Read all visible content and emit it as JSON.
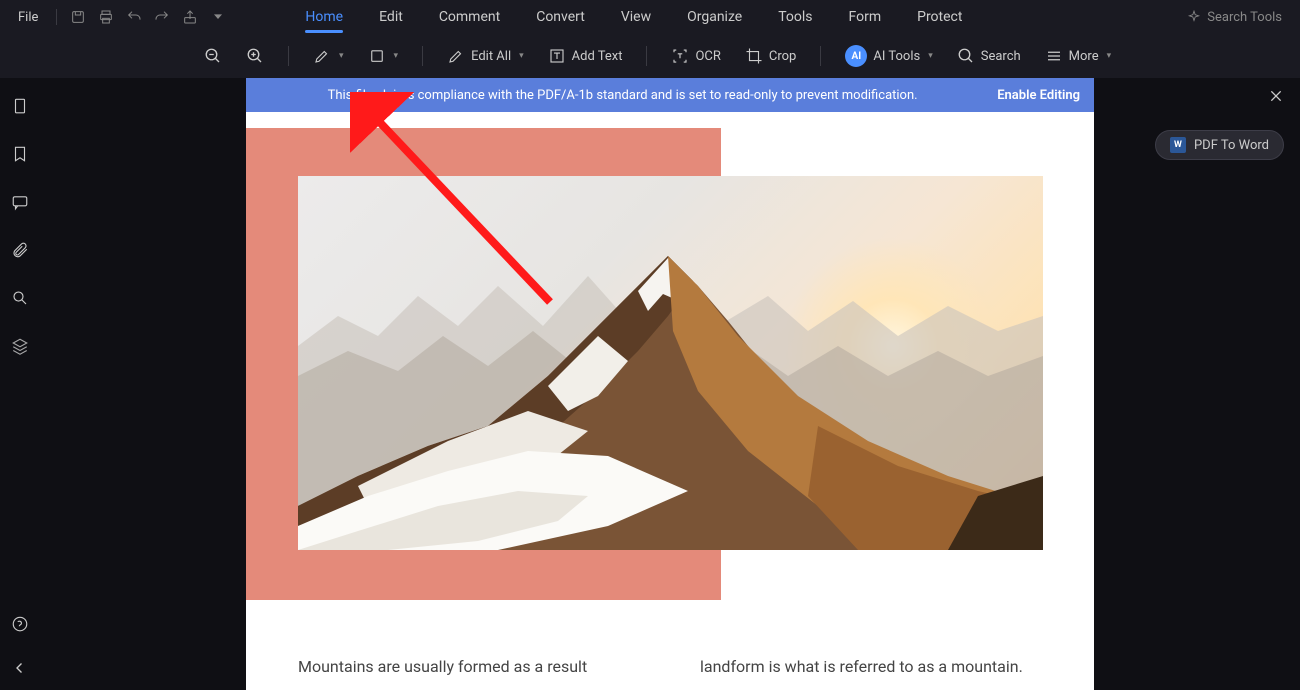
{
  "menubar": {
    "file": "File",
    "tabs": [
      "Home",
      "Edit",
      "Comment",
      "Convert",
      "View",
      "Organize",
      "Tools",
      "Form",
      "Protect"
    ],
    "active_tab": 0,
    "search_placeholder": "Search Tools"
  },
  "toolbar": {
    "edit_all": "Edit All",
    "add_text": "Add Text",
    "ocr": "OCR",
    "crop": "Crop",
    "ai_tools": "AI Tools",
    "search": "Search",
    "more": "More"
  },
  "banner": {
    "message": "This file claims compliance with the PDF/A-1b standard and is set to read-only to prevent modification.",
    "action": "Enable Editing"
  },
  "pill": {
    "label": "PDF To Word",
    "badge": "W"
  },
  "document": {
    "col1": "Mountains are usually formed as a result",
    "col2": "landform is what is referred to as a mountain."
  }
}
